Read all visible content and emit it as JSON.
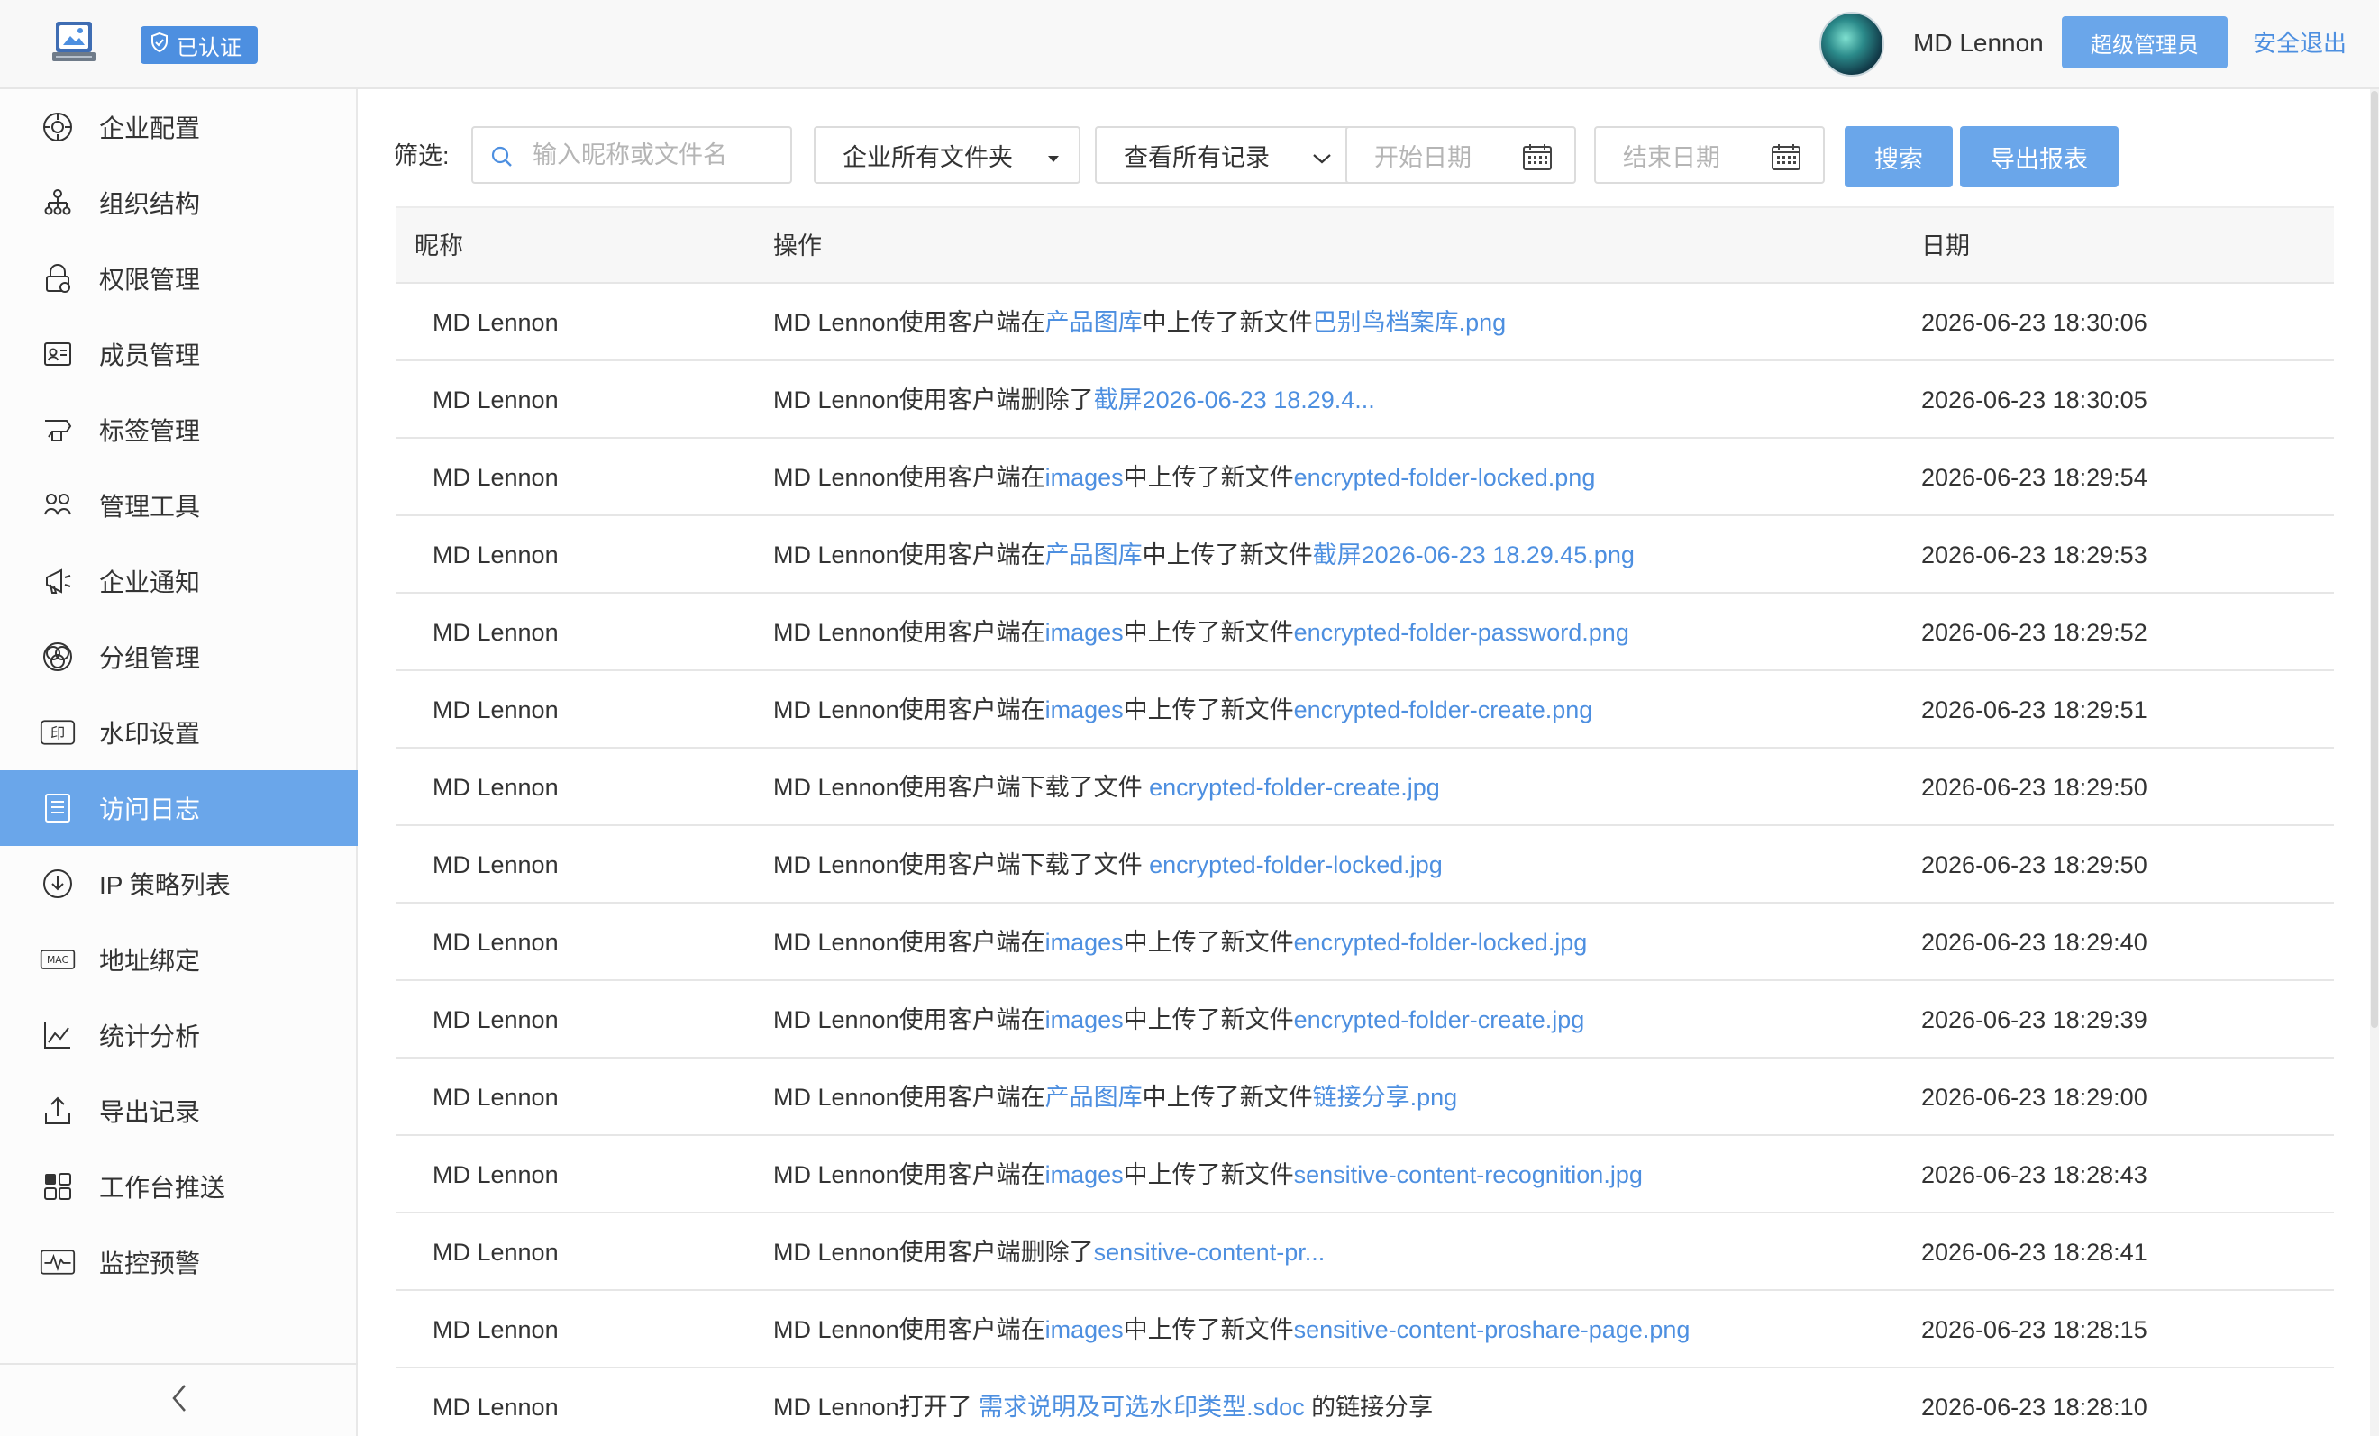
{
  "header": {
    "verified_label": "已认证",
    "username": "MD Lennon",
    "role_label": "超级管理员",
    "logout_label": "安全退出"
  },
  "sidebar": {
    "items": [
      {
        "label": "企业配置",
        "icon": "settings-icon"
      },
      {
        "label": "组织结构",
        "icon": "org-chart-icon"
      },
      {
        "label": "权限管理",
        "icon": "permission-icon"
      },
      {
        "label": "成员管理",
        "icon": "member-card-icon"
      },
      {
        "label": "标签管理",
        "icon": "tag-icon"
      },
      {
        "label": "管理工具",
        "icon": "tools-icon"
      },
      {
        "label": "企业通知",
        "icon": "megaphone-icon"
      },
      {
        "label": "分组管理",
        "icon": "group-circles-icon"
      },
      {
        "label": "水印设置",
        "icon": "watermark-icon"
      },
      {
        "label": "访问日志",
        "icon": "log-list-icon",
        "active": true
      },
      {
        "label": "IP 策略列表",
        "icon": "ip-download-icon"
      },
      {
        "label": "地址绑定",
        "icon": "mac-icon"
      },
      {
        "label": "统计分析",
        "icon": "chart-icon"
      },
      {
        "label": "导出记录",
        "icon": "export-icon"
      },
      {
        "label": "工作台推送",
        "icon": "workspace-icon"
      },
      {
        "label": "监控预警",
        "icon": "monitor-icon"
      }
    ]
  },
  "filter": {
    "label": "筛选:",
    "search_placeholder": "输入昵称或文件名",
    "folder_select": "企业所有文件夹",
    "record_select": "查看所有记录",
    "start_date_placeholder": "开始日期",
    "end_date_placeholder": "结束日期",
    "search_button": "搜索",
    "export_button": "导出报表"
  },
  "table": {
    "headers": {
      "nickname": "昵称",
      "action": "操作",
      "date": "日期"
    },
    "rows": [
      {
        "nickname": "MD Lennon",
        "parts": [
          {
            "t": "MD Lennon使用客户端在"
          },
          {
            "t": "产品图库",
            "link": true
          },
          {
            "t": "中上传了新文件"
          },
          {
            "t": "巴别鸟档案库.png",
            "link": true
          }
        ],
        "date": "2026-06-23 18:30:06"
      },
      {
        "nickname": "MD Lennon",
        "parts": [
          {
            "t": "MD Lennon使用客户端删除了"
          },
          {
            "t": "截屏2026-06-23 18.29.4...",
            "link": true
          }
        ],
        "date": "2026-06-23 18:30:05"
      },
      {
        "nickname": "MD Lennon",
        "parts": [
          {
            "t": "MD Lennon使用客户端在"
          },
          {
            "t": "images",
            "link": true
          },
          {
            "t": "中上传了新文件"
          },
          {
            "t": "encrypted-folder-locked.png",
            "link": true
          }
        ],
        "date": "2026-06-23 18:29:54"
      },
      {
        "nickname": "MD Lennon",
        "parts": [
          {
            "t": "MD Lennon使用客户端在"
          },
          {
            "t": "产品图库",
            "link": true
          },
          {
            "t": "中上传了新文件"
          },
          {
            "t": "截屏2026-06-23 18.29.45.png",
            "link": true
          }
        ],
        "date": "2026-06-23 18:29:53"
      },
      {
        "nickname": "MD Lennon",
        "parts": [
          {
            "t": "MD Lennon使用客户端在"
          },
          {
            "t": "images",
            "link": true
          },
          {
            "t": "中上传了新文件"
          },
          {
            "t": "encrypted-folder-password.png",
            "link": true
          }
        ],
        "date": "2026-06-23 18:29:52"
      },
      {
        "nickname": "MD Lennon",
        "parts": [
          {
            "t": "MD Lennon使用客户端在"
          },
          {
            "t": "images",
            "link": true
          },
          {
            "t": "中上传了新文件"
          },
          {
            "t": "encrypted-folder-create.png",
            "link": true
          }
        ],
        "date": "2026-06-23 18:29:51"
      },
      {
        "nickname": "MD Lennon",
        "parts": [
          {
            "t": "MD Lennon使用客户端下载了文件 "
          },
          {
            "t": "encrypted-folder-create.jpg",
            "link": true
          }
        ],
        "date": "2026-06-23 18:29:50"
      },
      {
        "nickname": "MD Lennon",
        "parts": [
          {
            "t": "MD Lennon使用客户端下载了文件 "
          },
          {
            "t": "encrypted-folder-locked.jpg",
            "link": true
          }
        ],
        "date": "2026-06-23 18:29:50"
      },
      {
        "nickname": "MD Lennon",
        "parts": [
          {
            "t": "MD Lennon使用客户端在"
          },
          {
            "t": "images",
            "link": true
          },
          {
            "t": "中上传了新文件"
          },
          {
            "t": "encrypted-folder-locked.jpg",
            "link": true
          }
        ],
        "date": "2026-06-23 18:29:40"
      },
      {
        "nickname": "MD Lennon",
        "parts": [
          {
            "t": "MD Lennon使用客户端在"
          },
          {
            "t": "images",
            "link": true
          },
          {
            "t": "中上传了新文件"
          },
          {
            "t": "encrypted-folder-create.jpg",
            "link": true
          }
        ],
        "date": "2026-06-23 18:29:39"
      },
      {
        "nickname": "MD Lennon",
        "parts": [
          {
            "t": "MD Lennon使用客户端在"
          },
          {
            "t": "产品图库",
            "link": true
          },
          {
            "t": "中上传了新文件"
          },
          {
            "t": "链接分享.png",
            "link": true
          }
        ],
        "date": "2026-06-23 18:29:00"
      },
      {
        "nickname": "MD Lennon",
        "parts": [
          {
            "t": "MD Lennon使用客户端在"
          },
          {
            "t": "images",
            "link": true
          },
          {
            "t": "中上传了新文件"
          },
          {
            "t": "sensitive-content-recognition.jpg",
            "link": true
          }
        ],
        "date": "2026-06-23 18:28:43"
      },
      {
        "nickname": "MD Lennon",
        "parts": [
          {
            "t": "MD Lennon使用客户端删除了"
          },
          {
            "t": "sensitive-content-pr...",
            "link": true
          }
        ],
        "date": "2026-06-23 18:28:41"
      },
      {
        "nickname": "MD Lennon",
        "parts": [
          {
            "t": "MD Lennon使用客户端在"
          },
          {
            "t": "images",
            "link": true
          },
          {
            "t": "中上传了新文件"
          },
          {
            "t": "sensitive-content-proshare-page.png",
            "link": true
          }
        ],
        "date": "2026-06-23 18:28:15"
      },
      {
        "nickname": "MD Lennon",
        "parts": [
          {
            "t": "MD Lennon打开了 "
          },
          {
            "t": "需求说明及可选水印类型.sdoc",
            "link": true
          },
          {
            "t": " 的链接分享"
          }
        ],
        "date": "2026-06-23 18:28:10"
      }
    ]
  }
}
